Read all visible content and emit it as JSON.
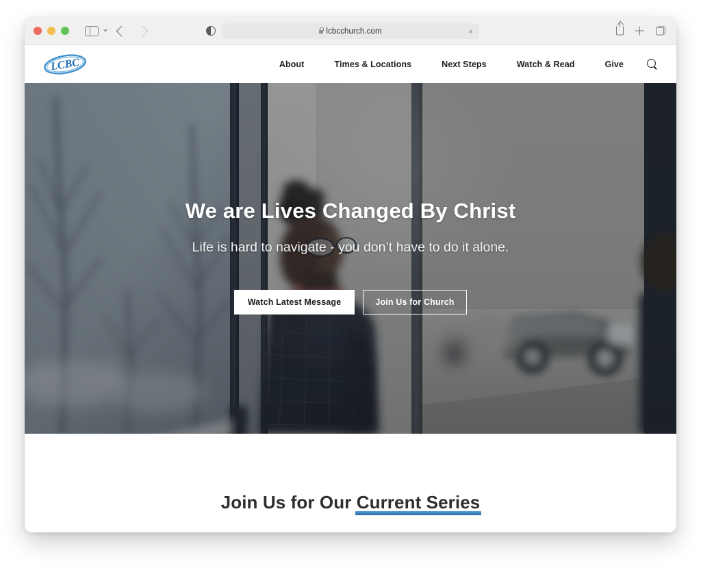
{
  "browser": {
    "traffic_lights": [
      "close",
      "minimize",
      "zoom"
    ],
    "sidebar_toggle": "sidebar-toggle",
    "back_label": "Back",
    "forward_label": "Forward",
    "privacy_report_label": "Privacy Report",
    "url": "lcbcchurch.com",
    "url_clear_label": "×",
    "lock": "secure-lock",
    "share_label": "Share",
    "new_tab_label": "New Tab",
    "tab_overview_label": "Tab Overview"
  },
  "site": {
    "logo_text": "LCBC",
    "nav": [
      {
        "label": "About"
      },
      {
        "label": "Times & Locations"
      },
      {
        "label": "Next Steps"
      },
      {
        "label": "Watch & Read"
      },
      {
        "label": "Give"
      }
    ],
    "search_icon": "search-icon"
  },
  "hero": {
    "title": "We are Lives Changed By Christ",
    "subtitle": "Life is hard to navigate - you don’t have to do it alone.",
    "buttons": [
      {
        "label": "Watch Latest Message",
        "style": "filled"
      },
      {
        "label": "Join Us for Church",
        "style": "outline"
      }
    ]
  },
  "series": {
    "heading_prefix": "Join Us for Our ",
    "heading_highlight": "Current Series"
  },
  "colors": {
    "brand_blue": "#2f7fc4",
    "highlight_underline": "#3a7fbd",
    "hero_text": "#ffffff",
    "nav_text": "#1d1d1d",
    "toolbar_bg": "#f0f0ef"
  }
}
